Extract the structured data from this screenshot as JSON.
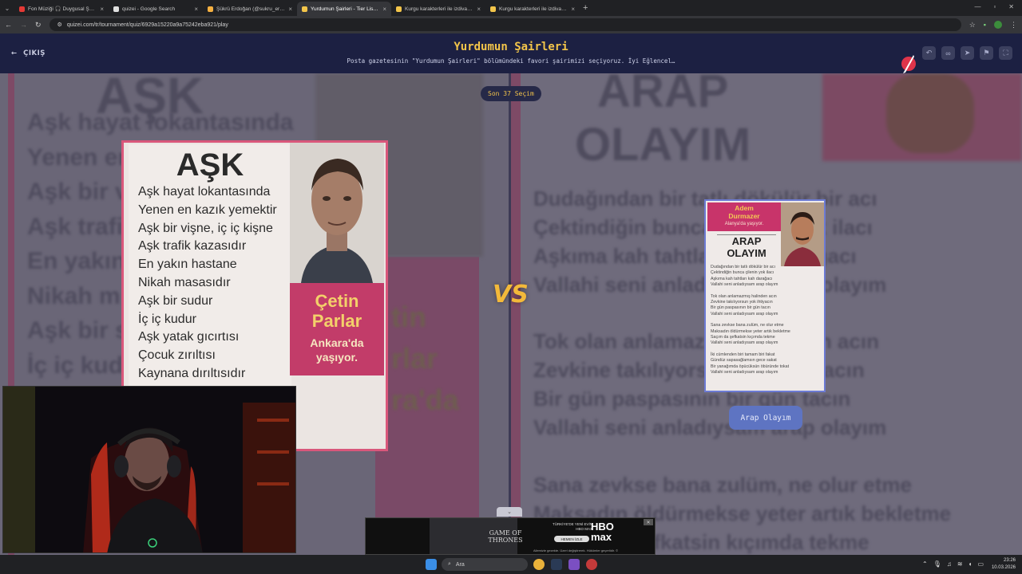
{
  "browser": {
    "tabs": [
      {
        "label": "Fon Müziği 🎧 Duygusal Şarkılar",
        "color": "#e53935",
        "active": false
      },
      {
        "label": "quizei - Google Search",
        "color": "#e0e0e0",
        "active": false
      },
      {
        "label": "Şükrü Erdoğan (@sukru_erdogan)",
        "color": "#f5b041",
        "active": false
      },
      {
        "label": "Yurdumun Şairleri - Tier List, En İyi",
        "color": "#f3c54a",
        "active": true
      },
      {
        "label": "Kurgu karakterleri ile izdivaç | En İyi",
        "color": "#f3c54a",
        "active": false
      },
      {
        "label": "Kurgu karakterleri ile izdivaç | En İyi",
        "color": "#f3c54a",
        "active": false
      }
    ],
    "url": "quizei.com/tr/tournament/quiz/6929a15220a9a75242eba921/play"
  },
  "header": {
    "back_label": "ÇIKIŞ",
    "title": "Yurdumun Şairleri",
    "subtitle": "Posta gazetesinin \"Yurdumun Şairleri\" bölümündeki favori şairimizi seçiyoruz. İyi Eğlencel…",
    "icons": [
      "undo-icon",
      "link-icon",
      "share-icon",
      "flag-icon",
      "fullscreen-icon"
    ]
  },
  "round": {
    "label": "Son 37 Seçim",
    "vs": "VS"
  },
  "left": {
    "poem_title": "AŞK",
    "lines": [
      "Aşk hayat lokantasında",
      "Yenen en kazık yemektir",
      "Aşk bir vişne, iç iç kişne",
      "Aşk trafik kazasıdır",
      "En yakın hastane",
      "Nikah masasıdır",
      "Aşk bir sudur",
      "İç iç kudur",
      "Aşk yatak gıcırtısı",
      "Çocuk zırıltısı",
      "Kaynana dırıltısıdır"
    ],
    "poet_first": "Çetin",
    "poet_last": "Parlar",
    "location": "Ankara'da yaşıyor."
  },
  "right": {
    "poet_first": "Adem",
    "poet_last": "Durmazer",
    "location": "Alanya'da yaşıyor.",
    "poem_title": "ARAP OLAYIM",
    "stanzas": [
      [
        "Dudağından bir tatlı dökülür bir acı",
        "Çektindiğin bunca çilenin yok ilacı",
        "Aşkıma kah tahtları kah darağacı",
        "Vallahi seni anladıysam arap olayım"
      ],
      [
        "Tok olan anlamazmış halinden acın",
        "Zevkine takılıyorsun yok ihtiyacın",
        "Bir gün paspasının bir gün tacın",
        "Vallahi seni anladıysam arap olayım"
      ],
      [
        "Sana zevkse bana zulüm, ne olur etme",
        "Maksadın öldürmekse yeter artık bekletme",
        "Saçım da şefkatsin kıçımda tekme",
        "Vallahi seni anladıysam arap olayım"
      ],
      [
        "İki cümlenden biri tamam biri fakat",
        "Gündüz sapasağlamsın gece sakat",
        "Bir yanağımda öpücüksün öbüründe tokat",
        "Vallahi seni anladıysam arap olayım"
      ]
    ],
    "choose_label": "Arap Olayım"
  },
  "background": {
    "left_title": "AŞK",
    "left_text": "Aşk hayat lokantasında\nYenen en kazık\nAşk bir vi\nAşk trafik\nEn yakın\nNikah m\nAşk bir su\nİç iç kudu",
    "left_poet": "tin\nrlar\nra'da",
    "right_title": "ARAP\nOLAYIM",
    "right_text": "Dudağından bir tatlı dökülür bir acı\nÇektindiğin bunca çilenin yok ilacı\nAşkıma kah tahtları kah darağacı\nVallahi seni anladıysam arap olayım\n\nTok olan anlamazmış halinden acın\nZevkine takılıyorsun yok ihtiyacın\nBir gün paspasının bir gün tacın\nVallahi seni anladıysam arap olayım\n\nSana zevkse bana zulüm, ne olur etme\nMaksadın öldürmekse yeter artık bekletme\nSaçım da şefkatsin kıçımda tekme"
  },
  "ad": {
    "show": "GAME OF THRONES",
    "brand": "HBO max",
    "tagline": "TÜRKİYE'DE YENİ EVİN HBO MAX",
    "cta": "HEMEN İZLE",
    "footer": "Ailemizle gezekte. Üzeri değiştirerek. Hükümler geçerlidir. ©"
  },
  "taskbar": {
    "search_label": "Ara",
    "time": "23:26",
    "date": "10.03.2026"
  }
}
